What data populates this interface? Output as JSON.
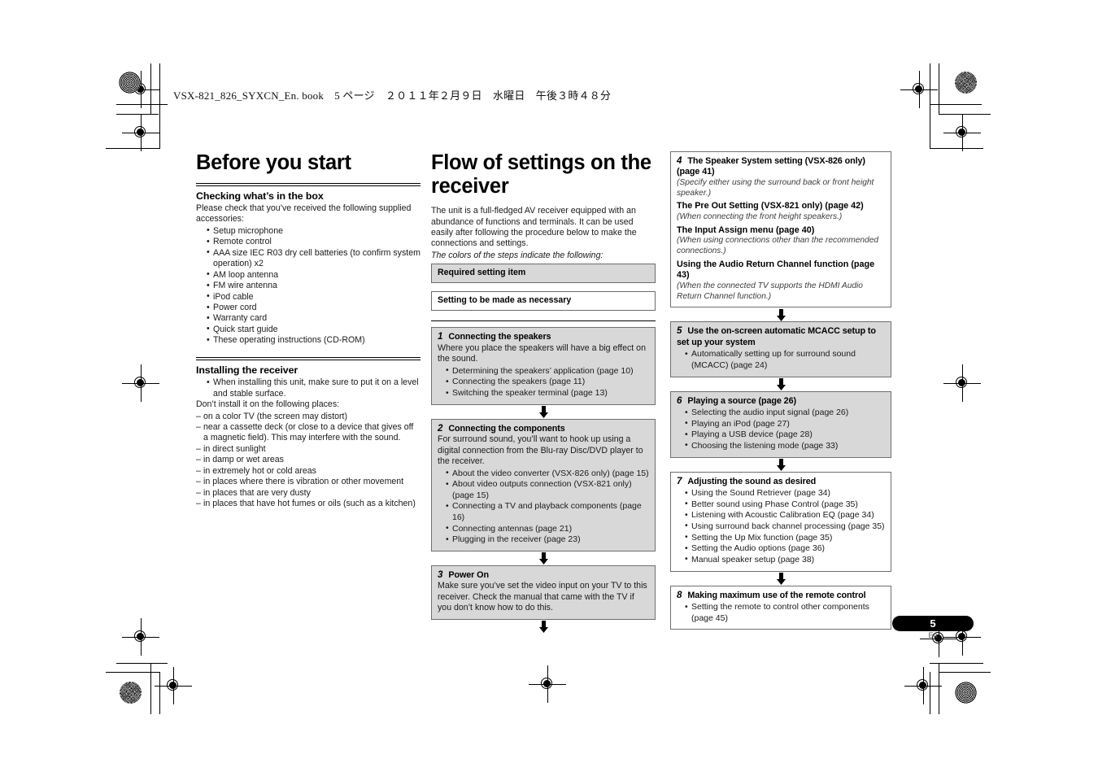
{
  "book_header": "VSX-821_826_SYXCN_En. book　5 ページ　２０１１年２月９日　水曜日　午後３時４８分",
  "page_number": "5",
  "page_lang": "En",
  "colors": {
    "step_filled": "#d8d8d8",
    "step_open": "#ffffff",
    "border": "#6f6f6f",
    "text": "#1a1a1a",
    "badge": "#000000"
  },
  "left_column": {
    "title": "Before you start",
    "section1": {
      "heading": "Checking what’s in the box",
      "intro": "Please check that you’ve received the following supplied accessories:",
      "items": [
        "Setup microphone",
        "Remote control",
        "AAA size IEC R03 dry cell batteries (to confirm system operation) x2",
        "AM loop antenna",
        "FM wire antenna",
        "iPod cable",
        "Power cord",
        "Warranty card",
        "Quick start guide",
        "These operating instructions (CD-ROM)"
      ]
    },
    "section2": {
      "heading": "Installing the receiver",
      "bullets": [
        "When installing this unit, make sure to put it on a level and stable surface."
      ],
      "intro": "Don’t install it on the following places:",
      "dashes": [
        "on a color TV (the screen may distort)",
        "near a cassette deck (or close to a device that gives off a magnetic field). This may interfere with the sound.",
        "in direct sunlight",
        "in damp or wet areas",
        "in extremely hot or cold areas",
        "in places where there is vibration or other movement",
        "in places that are very dusty",
        "in places that have hot fumes or oils (such as a kitchen)"
      ]
    }
  },
  "mid_column": {
    "title": "Flow of settings on the receiver",
    "intro": "The unit is a full-fledged AV receiver equipped with an abundance of functions and terminals. It can be used easily after following the procedure below to make the connections and settings.",
    "legend_intro": "The colors of the steps indicate the following:",
    "legend": [
      {
        "label": "Required setting item",
        "fill": "filled"
      },
      {
        "label": "Setting to be made as necessary",
        "fill": "open"
      }
    ],
    "steps": [
      {
        "num": "1",
        "title": "Connecting the speakers",
        "fill": "filled",
        "text": "Where you place the speakers will have a big effect on the sound.",
        "bullets": [
          "Determining the speakers’ application (page 10)",
          "Connecting the speakers (page 11)",
          "Switching the speaker terminal (page 13)"
        ]
      },
      {
        "num": "2",
        "title": "Connecting the components",
        "fill": "filled",
        "text": "For surround sound, you’ll want to hook up using a digital connection from the Blu-ray Disc/DVD player to the receiver.",
        "bullets": [
          "About the video converter (VSX-826 only) (page 15)",
          "About video outputs connection (VSX-821 only) (page 15)",
          "Connecting a TV and playback components (page 16)",
          "Connecting antennas (page 21)",
          "Plugging in the receiver (page 23)"
        ]
      },
      {
        "num": "3",
        "title": "Power On",
        "fill": "filled",
        "text": "Make sure you’ve set the video input on your TV to this receiver. Check the manual that came with the TV if you don’t know how to do this.",
        "bullets": []
      }
    ]
  },
  "right_column": {
    "steps": [
      {
        "num": "4",
        "title": "The Speaker System setting (VSX-826 only) (page 41)",
        "fill": "open",
        "note": "(Specify either using the surround back or front height speaker.)",
        "subsections": [
          {
            "heading": "The Pre Out Setting (VSX-821 only) (page 42)",
            "note": "(When connecting the front height speakers.)"
          },
          {
            "heading": "The Input Assign menu (page 40)",
            "note": "(When using connections other than the recommended connections.)"
          },
          {
            "heading": "Using the Audio Return Channel function (page 43)",
            "note": "(When the connected TV supports the HDMI Audio Return Channel function.)"
          }
        ]
      },
      {
        "num": "5",
        "title": "Use the on-screen automatic MCACC setup to set up your system",
        "fill": "filled",
        "bullets": [
          "Automatically setting up for surround sound (MCACC) (page 24)"
        ]
      },
      {
        "num": "6",
        "title": "Playing a source (page 26)",
        "fill": "filled",
        "bullets": [
          "Selecting the audio input signal (page 26)",
          "Playing an iPod (page 27)",
          "Playing a USB device (page 28)",
          "Choosing the listening mode (page 33)"
        ]
      },
      {
        "num": "7",
        "title": "Adjusting the sound as desired",
        "fill": "open",
        "bullets": [
          "Using the Sound Retriever (page 34)",
          "Better sound using Phase Control (page 35)",
          "Listening with Acoustic Calibration EQ (page 34)",
          "Using surround back channel processing (page 35)",
          "Setting the Up Mix function (page 35)",
          "Setting the Audio options (page 36)",
          "Manual speaker setup (page 38)"
        ]
      },
      {
        "num": "8",
        "title": "Making maximum use of the remote control",
        "fill": "open",
        "bullets": [
          "Setting the remote to control other components (page 45)"
        ]
      }
    ]
  }
}
